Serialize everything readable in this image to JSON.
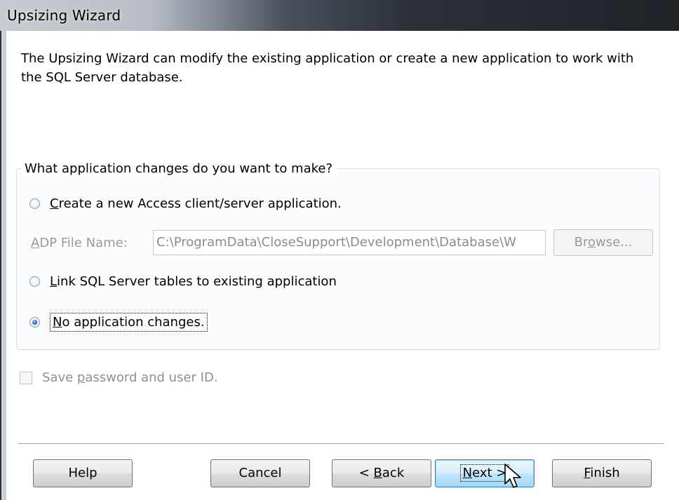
{
  "window": {
    "title": "Upsizing  Wizard"
  },
  "intro_text": "The Upsizing Wizard can modify the existing application or create a new application to work with the SQL Server database.",
  "group": {
    "legend": "What application changes do you want to make?",
    "options": [
      {
        "pre": "",
        "accel": "C",
        "post": "reate a new Access client/server application.",
        "checked": false
      },
      {
        "pre": "",
        "accel": "L",
        "post": "ink SQL Server tables to existing application",
        "checked": false
      },
      {
        "pre": "",
        "accel": "N",
        "post": "o application changes.",
        "checked": true
      }
    ],
    "adp": {
      "label_pre": "",
      "label_accel": "A",
      "label_post": "DP File Name:",
      "value": "C:\\ProgramData\\CloseSupport\\Development\\Database\\W",
      "browse_pre": "Br",
      "browse_accel": "o",
      "browse_post": "wse..."
    }
  },
  "save_password": {
    "pre": "Save ",
    "accel": "p",
    "post": "assword and user ID.",
    "checked": false,
    "enabled": false
  },
  "buttons": {
    "help": "Help",
    "cancel": "Cancel",
    "back": {
      "pre": "< ",
      "accel": "B",
      "post": "ack"
    },
    "next": {
      "pre": "",
      "accel": "N",
      "post": "ext >"
    },
    "finish": {
      "pre": "",
      "accel": "F",
      "post": "inish"
    }
  }
}
